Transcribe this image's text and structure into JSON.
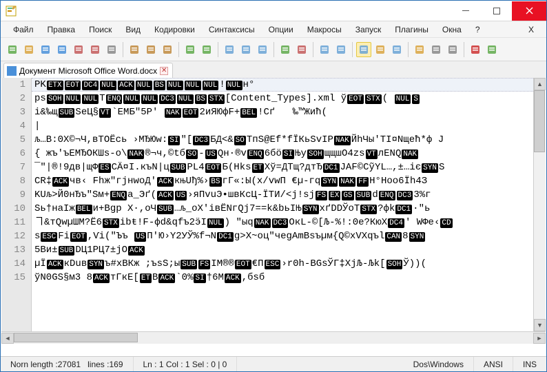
{
  "menu": [
    "Файл",
    "Правка",
    "Поиск",
    "Вид",
    "Кодировки",
    "Синтаксисы",
    "Опции",
    "Макросы",
    "Запуск",
    "Плагины",
    "Окна",
    "?",
    "X"
  ],
  "tab": {
    "label": "Документ Microsoft Office Word.docx"
  },
  "toolbar_icons": [
    "new",
    "open",
    "save",
    "save-all",
    "close",
    "close-all",
    "print",
    "",
    "cut",
    "copy",
    "paste",
    "",
    "undo",
    "redo",
    "",
    "find",
    "replace",
    "find-files",
    "",
    "zoom-in",
    "zoom-out",
    "",
    "sync-v",
    "sync-h",
    "",
    "wrap",
    "all-chars",
    "indent-guide",
    "",
    "folder",
    "doc-map",
    "func-list",
    "",
    "record",
    "play"
  ],
  "lines": [
    {
      "n": 1,
      "segs": [
        "PK",
        [
          "ETX"
        ],
        [
          "EOT"
        ],
        [
          "DC4"
        ],
        [
          "NUL"
        ],
        [
          "ACK"
        ],
        [
          "NUL"
        ],
        [
          "BS"
        ],
        [
          "NUL"
        ],
        [
          "NUL"
        ],
        [
          "NUL"
        ],
        "!",
        [
          "NUL"
        ],
        "н°"
      ]
    },
    {
      "n": 2,
      "segs": [
        "ps",
        [
          "SOH"
        ],
        [
          "NUL"
        ],
        [
          "NUL"
        ],
        "Т",
        [
          "ENQ"
        ],
        [
          "NUL"
        ],
        [
          "NUL"
        ],
        [
          "DC3"
        ],
        [
          "NUL"
        ],
        [
          "BS"
        ],
        [
          "STX"
        ],
        "[Content_Types].xml ў",
        [
          "EOT"
        ],
        [
          "STX"
        ],
        "( ",
        [
          "NUL"
        ],
        [
          "S"
        ]
      ]
    },
    {
      "n": 3,
      "segs": [
        "і&‰щ",
        [
          "SUB"
        ],
        "SeЦ§",
        [
          "VT"
        ],
        "`EMБ\"5P' ",
        [
          "NAK"
        ],
        [
          "EOT"
        ],
        "2иЯЮфF+",
        [
          "BEL"
        ],
        "!Cґ   ‰™Жиħ("
      ]
    },
    {
      "n": 4,
      "segs": [
        "|"
      ]
    },
    {
      "n": 5,
      "segs": [
        "љ…В:0X©¬Ч,вТОЁсь ›МЂЮw:",
        [
          "SI"
        ],
        "″[",
        [
          "DC3"
        ],
        "БД<&",
        [
          "SO"
        ],
        "ТпЅ@Ef*fЇКьЅvІР",
        [
          "NAK"
        ],
        "ЙhЧы'ТІ¤Nщећ*ф Ј"
      ]
    },
    {
      "n": 6,
      "segs": [
        "{ жъ'ъЕМЂОКШѕ-o\\",
        [
          "NAK"
        ],
        "®¬ч,©tб",
        [
          "SO"
        ],
        "-",
        [
          "US"
        ],
        "Qн·®v",
        [
          "ENQ"
        ],
        "6бӧ",
        [
          "SI"
        ],
        "Њу",
        [
          "SOH"
        ],
        "щщшO4zѕ",
        [
          "VT"
        ],
        "лЕNQ",
        [
          "NAK"
        ]
      ]
    },
    {
      "n": 7,
      "segs": [
        "¯\"|®!9дв|щФ",
        [
          "ES"
        ],
        "СӒ¤І.къN|ц",
        [
          "SUB"
        ],
        "PL4",
        [
          "EOT"
        ],
        "Б(Нkѕ",
        [
          "ET"
        ],
        "Хў=ДТщ?дтЂ",
        [
          "DC1"
        ],
        "JAF©CỹYL…,±…іє",
        [
          "SYN"
        ],
        "S"
      ]
    },
    {
      "n": 8,
      "segs": [
        "CR‡",
        [
          "ACK"
        ],
        "чв‹ Fhж\"гјнwоД'",
        [
          "ACK"
        ],
        "књUђ%›",
        [
          "BS"
        ],
        "гГ«:Ы(x/vwП €µ-гq",
        [
          "SYN"
        ],
        [
          "NAK"
        ],
        [
          "FF"
        ],
        "Н°Hoo6Ïh4З"
      ]
    },
    {
      "n": 9,
      "segs": [
        "KUљ>Й0нЂъ\"Sм+",
        [
          "ENQ"
        ],
        "a_Эґ(",
        [
          "ACK"
        ],
        [
          "US"
        ],
        "›яПvuЭ•швКcЦ-ЇТИ/<j!ѕj",
        [
          "FS"
        ],
        [
          "EX"
        ],
        [
          "GS"
        ],
        [
          "SUB"
        ],
        "d",
        [
          "ENQ"
        ],
        [
          "DC3"
        ],
        "3%г"
      ]
    },
    {
      "n": 10,
      "segs": [
        "Ѕь†наІж",
        [
          "BEL"
        ],
        "и+Вgр Х·,оЧ",
        [
          "SUB"
        ],
        "…љ_оХ'івЁNгQj7==k&bьIЊ",
        [
          "SYN"
        ],
        "хґDDЎоТ",
        [
          "STX"
        ],
        "?фk",
        [
          "DC1"
        ],
        "·″ь"
      ]
    },
    {
      "n": 11,
      "segs": [
        "ヿ&тQwµШМ?Ё6",
        [
          "STX"
        ],
        "ibŧ!F-фd&qfъ2ӭІ",
        [
          "NUL"
        ],
        ") \"ыq",
        [
          "NAK"
        ],
        [
          "DC3"
        ],
        "ОкL-©[Љ-%!:0е?КюХ",
        [
          "DC4"
        ],
        "' WФе‹",
        [
          "CD"
        ]
      ]
    },
    {
      "n": 12,
      "segs": [
        "ѕ",
        [
          "ESC"
        ],
        "Fі",
        [
          "EOT"
        ],
        ",Ѵі(\"Ъъ ",
        [
          "US"
        ],
        "П'Ю›Y2УЎ%f¬N",
        [
          "DC1"
        ],
        "g>X~оц\"чеgАmВsъµм{Q©хVХqъl",
        [
          "CAN"
        ],
        "8",
        [
          "SYN"
        ]
      ]
    },
    {
      "n": 13,
      "segs": [
        "5Ви±",
        [
          "SUB"
        ],
        "DЦ1РЦ7±jO",
        [
          "ACK"
        ]
      ]
    },
    {
      "n": 14,
      "segs": [
        "µÏ",
        [
          "ACK"
        ],
        "кDuв",
        [
          "SYN"
        ],
        "ъ#хВКж ;ъѕS;ы",
        [
          "SUB"
        ],
        [
          "FS"
        ],
        "ІМ®®",
        [
          "EOT"
        ],
        "€П",
        [
          "ESC"
        ],
        "›r0h-ВGѕЎГ‡XjЉ-Љk[",
        [
          "SOH"
        ],
        "Ў))( "
      ]
    },
    {
      "n": 15,
      "segs": [
        "ўN0GS§м3 8",
        [
          "ACK"
        ],
        "тГкЕ[",
        [
          "ET"
        ],
        "B",
        [
          "ACK"
        ],
        "`0%",
        [
          "SI"
        ],
        "†6М",
        [
          "ACK"
        ],
        ",бsб"
      ]
    }
  ],
  "status": {
    "length_label": "Norn length : ",
    "length": "27081",
    "lines_label": "lines : ",
    "lines": "169",
    "pos": "Ln : 1   Col : 1   Sel : 0 | 0",
    "eol": "Dos\\Windows",
    "enc": "ANSI",
    "ins": "INS"
  },
  "icon_colors": {
    "new": "#5fa94b",
    "open": "#d9a441",
    "save": "#4a90d9",
    "save-all": "#4a90d9",
    "close": "#c35b5b",
    "close-all": "#c35b5b",
    "print": "#888",
    "cut": "#c08a3e",
    "copy": "#c08a3e",
    "paste": "#c08a3e",
    "undo": "#5fa94b",
    "redo": "#5fa94b",
    "find": "#6aa3d5",
    "replace": "#6aa3d5",
    "find-files": "#6aa3d5",
    "zoom-in": "#5fa94b",
    "zoom-out": "#c35b5b",
    "sync-v": "#6aa3d5",
    "sync-h": "#6aa3d5",
    "wrap": "#6aa3d5",
    "all-chars": "#d9a441",
    "indent-guide": "#6aa3d5",
    "folder": "#d9a441",
    "doc-map": "#888",
    "func-list": "#888",
    "record": "#c33",
    "play": "#5fa94b"
  }
}
